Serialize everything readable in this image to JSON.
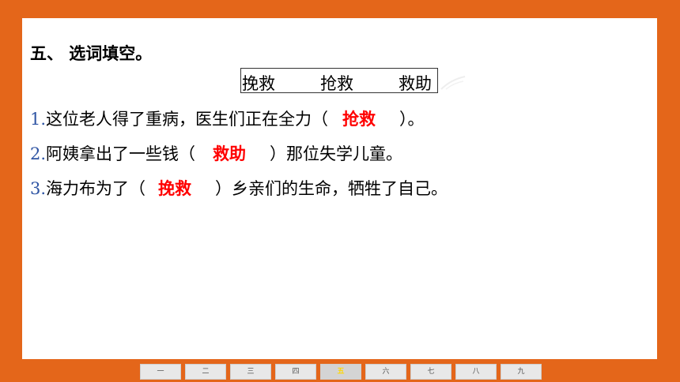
{
  "heading": "五、 选词填空。",
  "word_bank": [
    "挽救",
    "抢救",
    "救助"
  ],
  "sentences": [
    {
      "num": "1.",
      "before": "这位老人得了重病，医生们正在全力（",
      "answer": "抢救",
      "after": "）。"
    },
    {
      "num": "2.",
      "before": "阿姨拿出了一些钱（",
      "answer": "救助",
      "after": "）那位失学儿童。"
    },
    {
      "num": "3.",
      "before": "海力布为了（",
      "answer": "挽救",
      "after": "）乡亲们的生命，牺牲了自己。"
    }
  ],
  "nav": [
    "一",
    "二",
    "三",
    "四",
    "五",
    "六",
    "七",
    "八",
    "九"
  ],
  "nav_active_index": 4,
  "colors": {
    "border": "#e4661a",
    "answer": "#ff0000",
    "number": "#2f55a4",
    "nav_active": "#ffd700"
  }
}
